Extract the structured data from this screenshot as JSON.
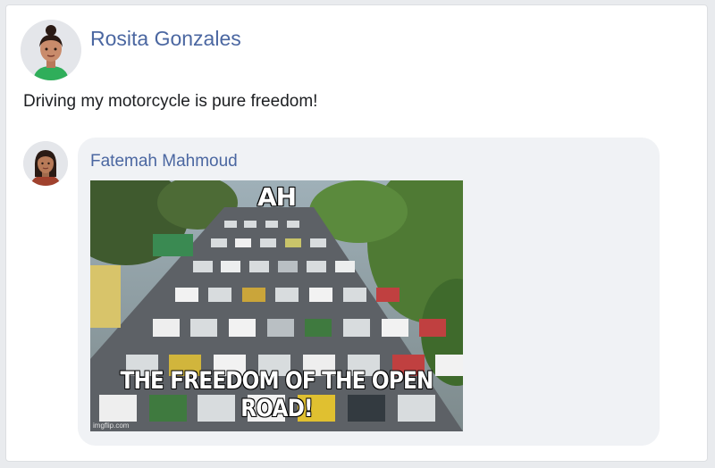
{
  "post": {
    "author": "Rosita Gonzales",
    "text": "Driving my motorcycle is pure freedom!",
    "avatar_icon": "woman-avatar-icon"
  },
  "comment": {
    "author": "Fatemah Mahmoud",
    "avatar_icon": "woman-avatar-icon",
    "meme": {
      "top_text": "AH",
      "bottom_text": "THE FREEDOM OF THE OPEN ROAD!",
      "watermark": "imgflip.com",
      "scene_icon": "traffic-jam-image"
    }
  },
  "colors": {
    "link": "#4b67a1",
    "bubble": "#f0f2f5",
    "card": "#ffffff"
  }
}
